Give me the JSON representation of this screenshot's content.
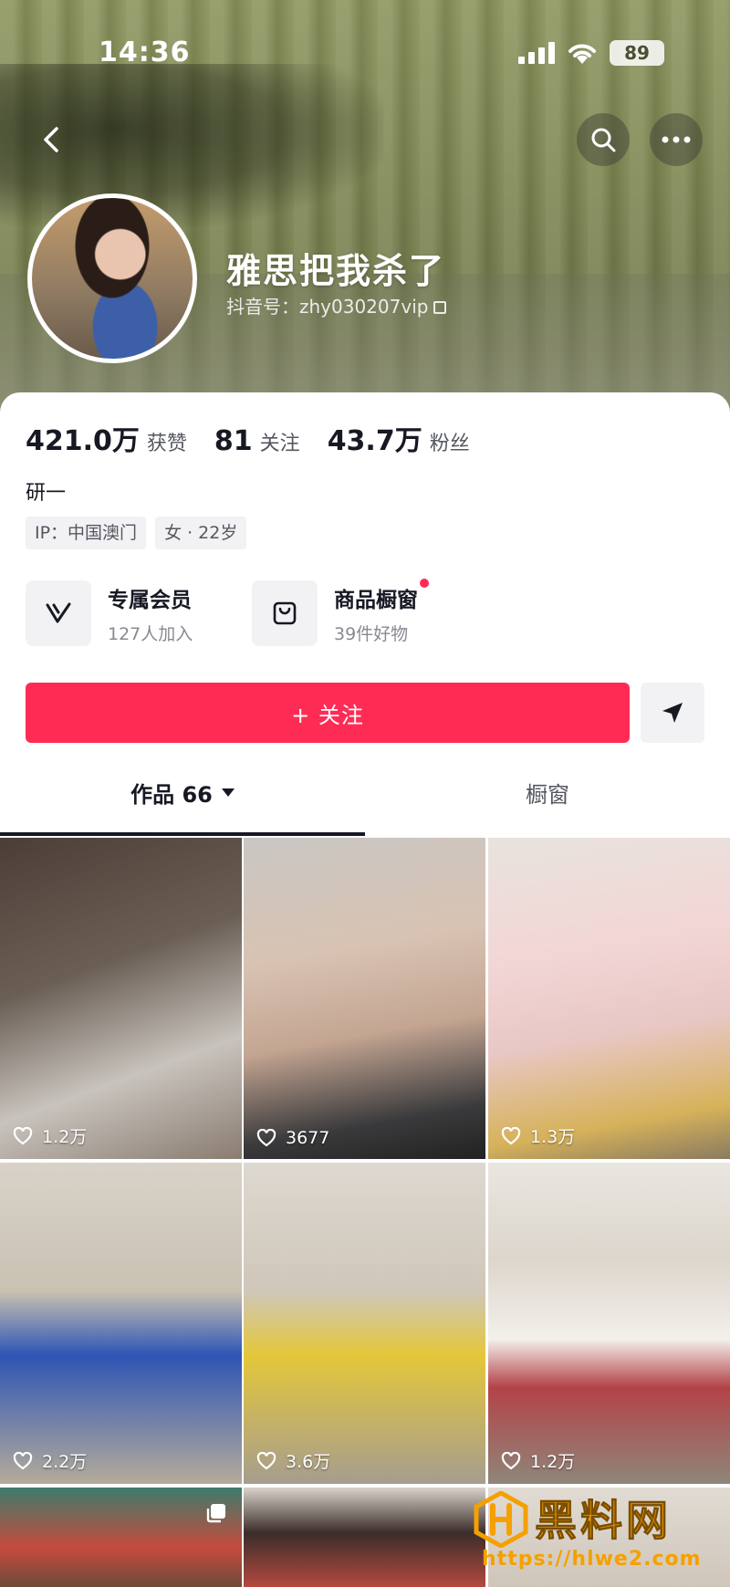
{
  "status_bar": {
    "time": "14:36",
    "battery": "89"
  },
  "profile": {
    "nickname": "雅思把我杀了",
    "douyin_id": "抖音号：zhy030207vip",
    "bio": "研一",
    "tags": [
      "IP：中国澳门",
      "女 · 22岁"
    ]
  },
  "stats": [
    {
      "number": "421.0万",
      "label": "获赞"
    },
    {
      "number": "81",
      "label": "关注"
    },
    {
      "number": "43.7万",
      "label": "粉丝"
    }
  ],
  "features": [
    {
      "title": "专属会员",
      "subtitle": "127人加入",
      "icon": "v-membership-icon"
    },
    {
      "title": "商品橱窗",
      "subtitle": "39件好物",
      "icon": "shopping-bag-icon"
    }
  ],
  "actions": {
    "follow_label": "+ 关注"
  },
  "tabs": [
    {
      "label": "作品 66"
    },
    {
      "label": "橱窗"
    }
  ],
  "videos": [
    {
      "likes": "1.2万"
    },
    {
      "likes": "3677"
    },
    {
      "likes": "1.3万"
    },
    {
      "likes": "2.2万"
    },
    {
      "likes": "3.6万"
    },
    {
      "likes": "1.2万"
    },
    {
      "likes": ""
    },
    {
      "likes": ""
    },
    {
      "likes": ""
    }
  ],
  "watermark": {
    "title": "黑料网",
    "url": "https://hlwe2.com"
  },
  "colors": {
    "accent": "#fe2c55",
    "watermark": "#f5a000"
  }
}
